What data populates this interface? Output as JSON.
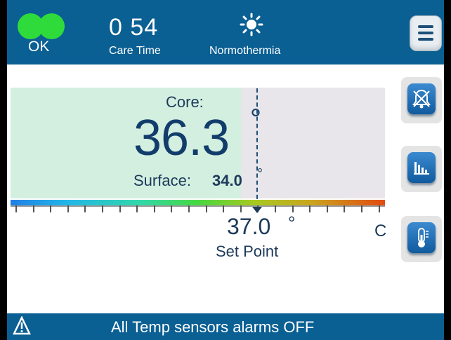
{
  "header": {
    "status_label": "OK",
    "care_time_value": "0 54",
    "care_time_label": "Care Time",
    "mode_label": "Normothermia",
    "mode_icon": "sun-icon",
    "menu_icon": "menu-icon"
  },
  "temperature": {
    "core_label": "Core:",
    "core_value": "36.3",
    "degree_symbol": "°",
    "surface_label": "Surface:",
    "surface_value": "34.0",
    "set_point_value": "37.0",
    "set_point_label": "Set Point",
    "unit": "C"
  },
  "side_buttons": [
    {
      "name": "alarm-off-button",
      "icon": "bell-crossed-icon"
    },
    {
      "name": "chart-button",
      "icon": "bar-chart-icon"
    },
    {
      "name": "thermometer-button",
      "icon": "thermometer-icon"
    }
  ],
  "status": {
    "icon": "warning-icon",
    "message": "All Temp sensors alarms OFF"
  },
  "colors": {
    "header_bg": "#0a5f93",
    "ok_indicator": "#2edb3b",
    "core_panel": "#d3efe0",
    "text_primary": "#123d6b"
  }
}
